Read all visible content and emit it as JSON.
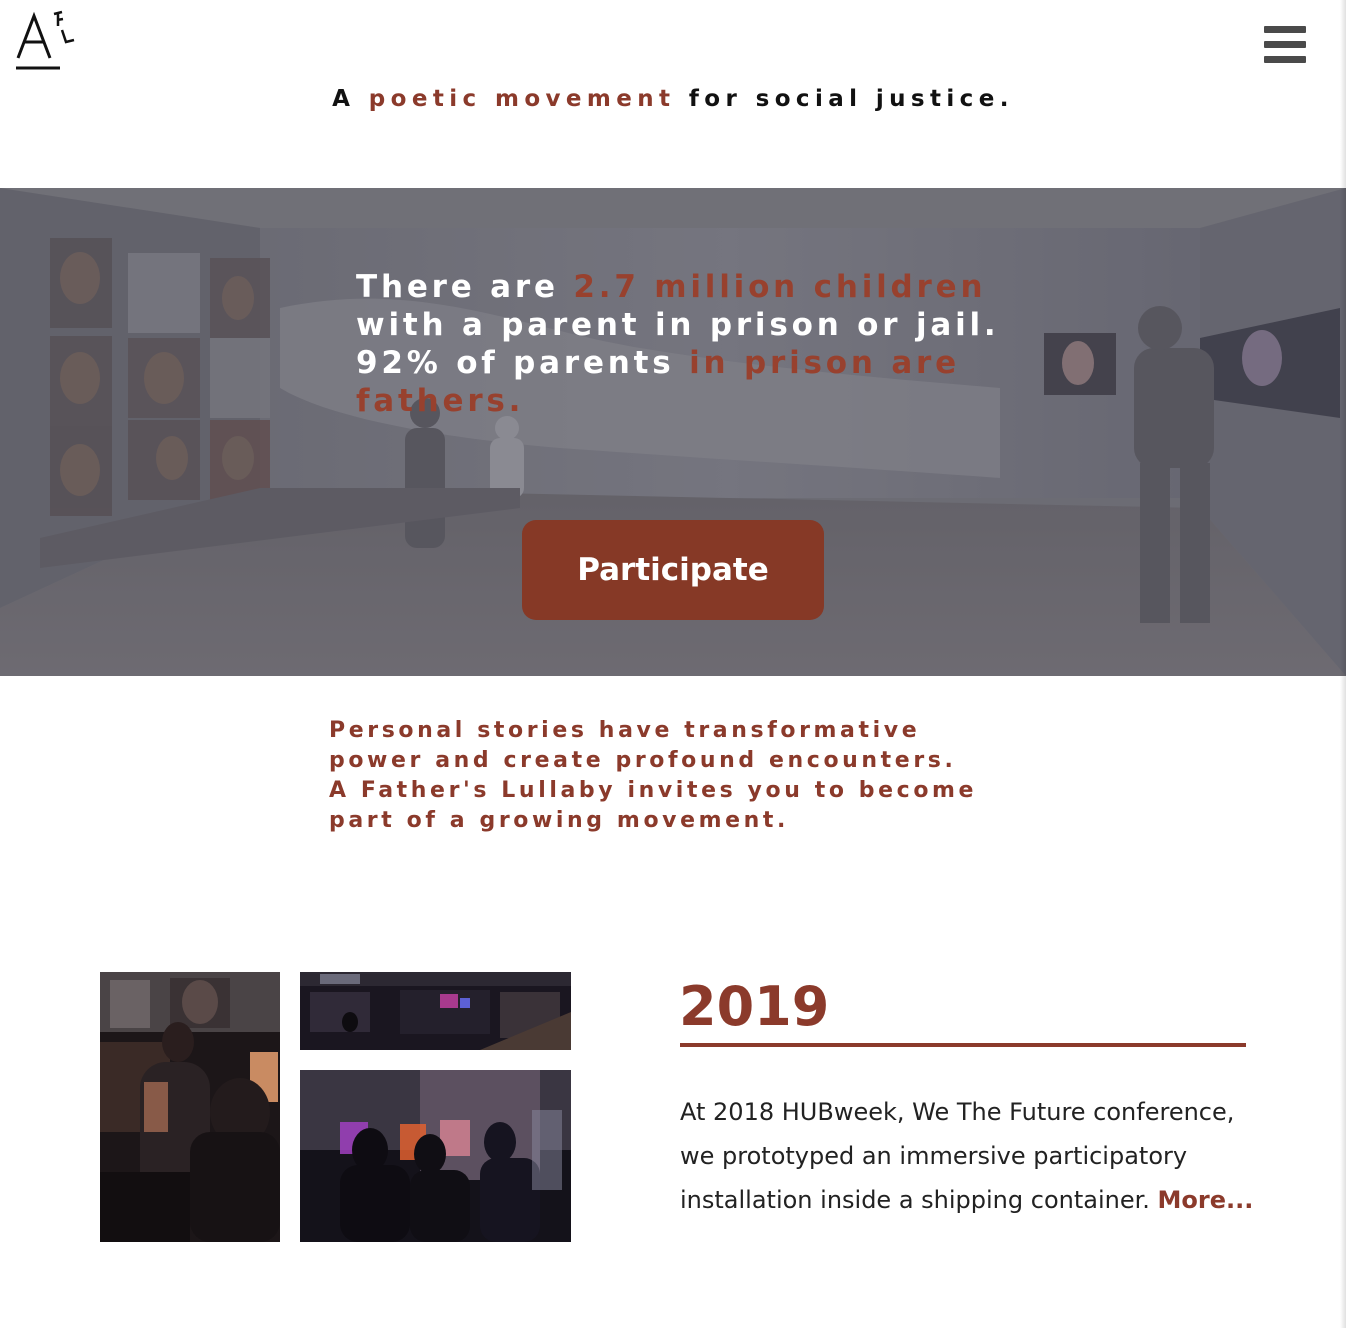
{
  "header": {
    "logo_text": "AFL",
    "menu_icon": "hamburger-menu-icon",
    "tagline": {
      "before": "A ",
      "accent": "poetic movement",
      "after": " for social justice."
    }
  },
  "hero": {
    "headline": {
      "part1": "There are ",
      "part2": "2.7 million children",
      "part3": "with a parent in prison or jail.",
      "part4": "92% of parents ",
      "part5": "in prison are fathers."
    },
    "cta_label": "Participate"
  },
  "intro": {
    "text": "Personal stories have transformative\npower and create profound encounters.\nA Father's Lullaby invites you to become\npart of a growing movement."
  },
  "section_2019": {
    "year": "2019",
    "body": "At 2018 HUBweek, We The Future conference, we prototyped an immersive participatory installation inside a shipping container. ",
    "more_label": "More..."
  },
  "colors": {
    "accent": "#8b3a2b",
    "button": "#863926",
    "text": "#111111",
    "hero_overlay": "#6d6d75"
  }
}
